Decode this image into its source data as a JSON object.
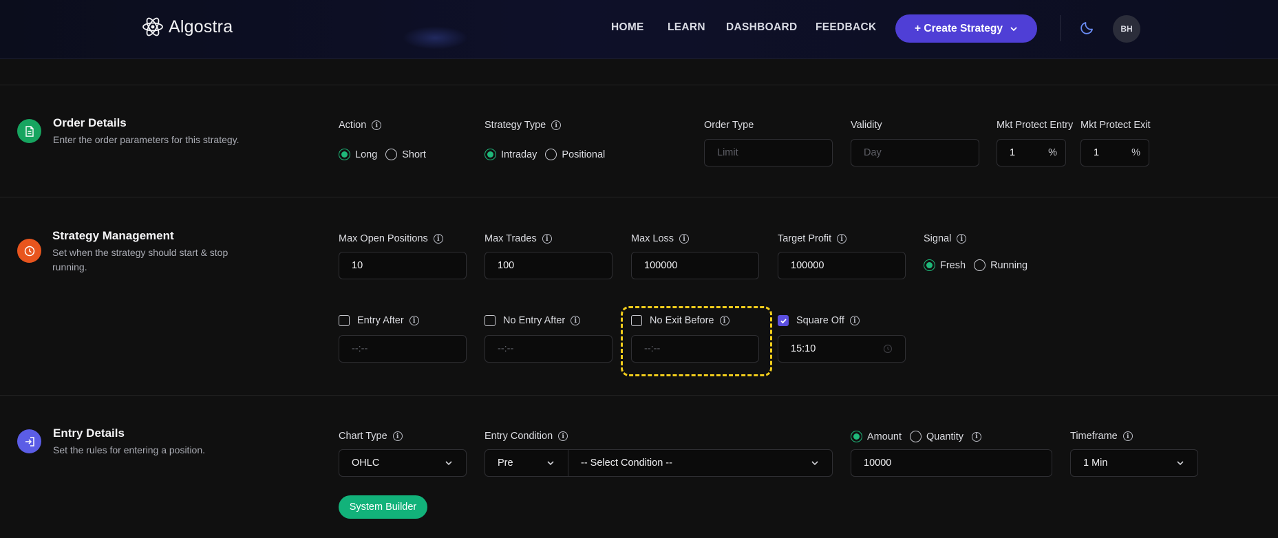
{
  "nav": {
    "brand": "Algostra",
    "links": [
      "HOME",
      "LEARN",
      "DASHBOARD",
      "FEEDBACK"
    ],
    "create_label": "+ Create Strategy",
    "avatar_initials": "BH"
  },
  "order_details": {
    "title": "Order Details",
    "description": "Enter the order parameters for this strategy.",
    "action": {
      "label": "Action",
      "options": [
        "Long",
        "Short"
      ],
      "selected": "Long"
    },
    "strategy_type": {
      "label": "Strategy Type",
      "options": [
        "Intraday",
        "Positional"
      ],
      "selected": "Intraday"
    },
    "order_type": {
      "label": "Order Type",
      "placeholder": "Limit"
    },
    "validity": {
      "label": "Validity",
      "placeholder": "Day"
    },
    "mkt_protect_entry": {
      "label": "Mkt Protect Entry",
      "value": "1",
      "suffix": "%"
    },
    "mkt_protect_exit": {
      "label": "Mkt Protect Exit",
      "value": "1",
      "suffix": "%"
    }
  },
  "strategy_management": {
    "title": "Strategy Management",
    "description": "Set when the strategy should start & stop running.",
    "max_open_positions": {
      "label": "Max Open Positions",
      "value": "10"
    },
    "max_trades": {
      "label": "Max Trades",
      "value": "100"
    },
    "max_loss": {
      "label": "Max Loss",
      "value": "100000"
    },
    "target_profit": {
      "label": "Target Profit",
      "value": "100000"
    },
    "signal": {
      "label": "Signal",
      "options": [
        "Fresh",
        "Running"
      ],
      "selected": "Fresh"
    },
    "entry_after": {
      "label": "Entry After",
      "checked": false,
      "placeholder": "--:--"
    },
    "no_entry_after": {
      "label": "No Entry After",
      "checked": false,
      "placeholder": "--:--"
    },
    "no_exit_before": {
      "label": "No Exit Before",
      "checked": false,
      "placeholder": "--:--"
    },
    "square_off": {
      "label": "Square Off",
      "checked": true,
      "value": "15:10"
    }
  },
  "entry_details": {
    "title": "Entry Details",
    "description": "Set the rules for entering a position.",
    "chart_type": {
      "label": "Chart Type",
      "value": "OHLC"
    },
    "entry_condition": {
      "label": "Entry Condition",
      "timing": "Pre",
      "condition": "-- Select Condition --"
    },
    "sizing": {
      "options": [
        "Amount",
        "Quantity"
      ],
      "selected": "Amount",
      "value": "10000"
    },
    "timeframe": {
      "label": "Timeframe",
      "value": "1 Min"
    },
    "system_builder_label": "System Builder"
  },
  "colors": {
    "accent_purple": "#4f3fd6",
    "accent_green": "#1fb87a",
    "highlight_yellow": "#f2cd1b"
  }
}
